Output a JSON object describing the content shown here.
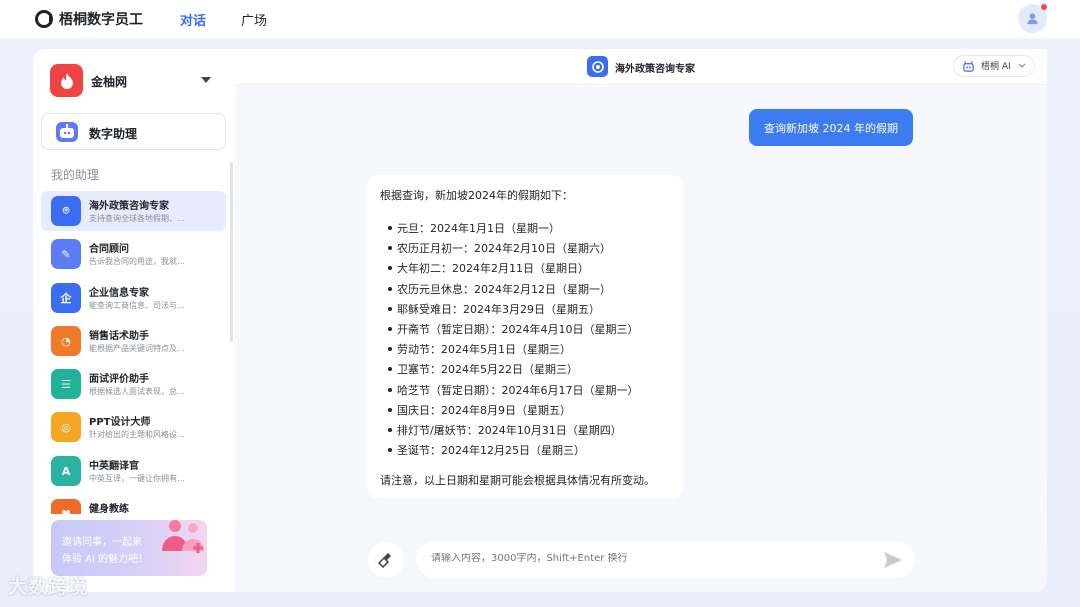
{
  "app": {
    "name": "梧桐数字员工"
  },
  "nav": {
    "tabs": [
      {
        "label": "对话"
      },
      {
        "label": "广场"
      }
    ]
  },
  "sidebar": {
    "workspace": "金柚网",
    "digital_assistant": "数字助理",
    "section_title": "我的助理",
    "assistants": [
      {
        "name": "海外政策咨询专家",
        "desc": "支持查询全球各地假期、…",
        "color": "#3a6df0",
        "glyph": "⌾"
      },
      {
        "name": "合同顾问",
        "desc": "告诉我合同的用途，我就…",
        "color": "#5b7cf5",
        "glyph": "✎"
      },
      {
        "name": "企业信息专家",
        "desc": "能查询工商信息、司法与…",
        "color": "#3a6df0",
        "glyph": "企"
      },
      {
        "name": "销售话术助手",
        "desc": "能根据产品关键词特点及…",
        "color": "#f07a2a",
        "glyph": "◔"
      },
      {
        "name": "面试评价助手",
        "desc": "根据候选人面试表现，总…",
        "color": "#20b39a",
        "glyph": "☰"
      },
      {
        "name": "PPT设计大师",
        "desc": "针对给出的主题和风格设…",
        "color": "#f5a623",
        "glyph": "◎"
      },
      {
        "name": "中英翻译官",
        "desc": "中英互译，一键让你拥有…",
        "color": "#2bb2a0",
        "glyph": "A"
      },
      {
        "name": "健身教练",
        "desc": "",
        "color": "#f06a2a",
        "glyph": "♥"
      }
    ],
    "invite": {
      "line1": "邀请同事，一起来",
      "line2": "体验 AI 的魅力吧！"
    }
  },
  "chat": {
    "agent_title": "海外政策咨询专家",
    "model": "梧桐 AI",
    "user_message": "查询新加坡 2024 年的假期",
    "bot": {
      "intro": "根据查询，新加坡2024年的假期如下：",
      "holidays": [
        "元旦：2024年1月1日（星期一）",
        "农历正月初一：2024年2月10日（星期六）",
        "大年初二：2024年2月11日（星期日）",
        "农历元旦休息：2024年2月12日（星期一）",
        "耶稣受难日：2024年3月29日（星期五）",
        "开斋节（暂定日期）：2024年4月10日（星期三）",
        "劳动节：2024年5月1日（星期三）",
        "卫塞节：2024年5月22日（星期三）",
        "哈芝节（暂定日期）：2024年6月17日（星期一）",
        "国庆日：2024年8月9日（星期五）",
        "排灯节/屠妖节：2024年10月31日（星期四）",
        "圣诞节：2024年12月25日（星期三）"
      ],
      "note": "请注意，以上日期和星期可能会根据具体情况有所变动。"
    },
    "input_placeholder": "请输入内容，3000字内，Shift+Enter 换行"
  },
  "watermark": "大数跨境"
}
